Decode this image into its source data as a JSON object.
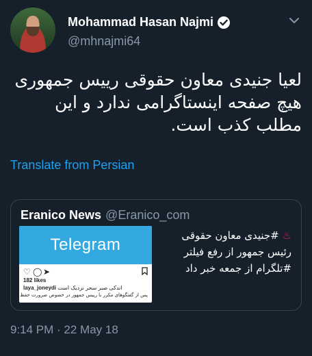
{
  "author": {
    "display_name": "Mohammad Hasan Najmi",
    "handle": "@mhnajmi64",
    "verified_icon": "verified-badge-icon",
    "avatar": "avatar"
  },
  "menu_icon": "chevron-down-icon",
  "tweet": {
    "text": "لعیا جنیدی معاون حقوقی رییس جمهوری هیچ صفحه اینستاگرامی ندارد و این مطلب کذب است.",
    "translate_label": "Translate from Persian",
    "timestamp": "9:14 PM · 22 May 18"
  },
  "quote": {
    "name": "Eranico News",
    "handle": "@Eranico_com",
    "emoji": "♨",
    "text": "#جنیدی معاون حقوقی رئیس جمهور از رفع فیلتر #تلگرام از جمعه خبر داد",
    "thumbnail": {
      "banner_text": "Telegram",
      "likes": "182 likes",
      "caption_user": "laya_joneydi",
      "caption_line1": "اندکی صبر سحر نزدیک است",
      "caption_line2": "پس از گفتگوهای مکرر با رییس جمهور در خصوص ضرورت حفظ و"
    }
  },
  "colors": {
    "background": "#15202b",
    "text": "#ffffff",
    "secondary": "#8899a6",
    "link": "#1da1f2",
    "border": "#38444d"
  }
}
